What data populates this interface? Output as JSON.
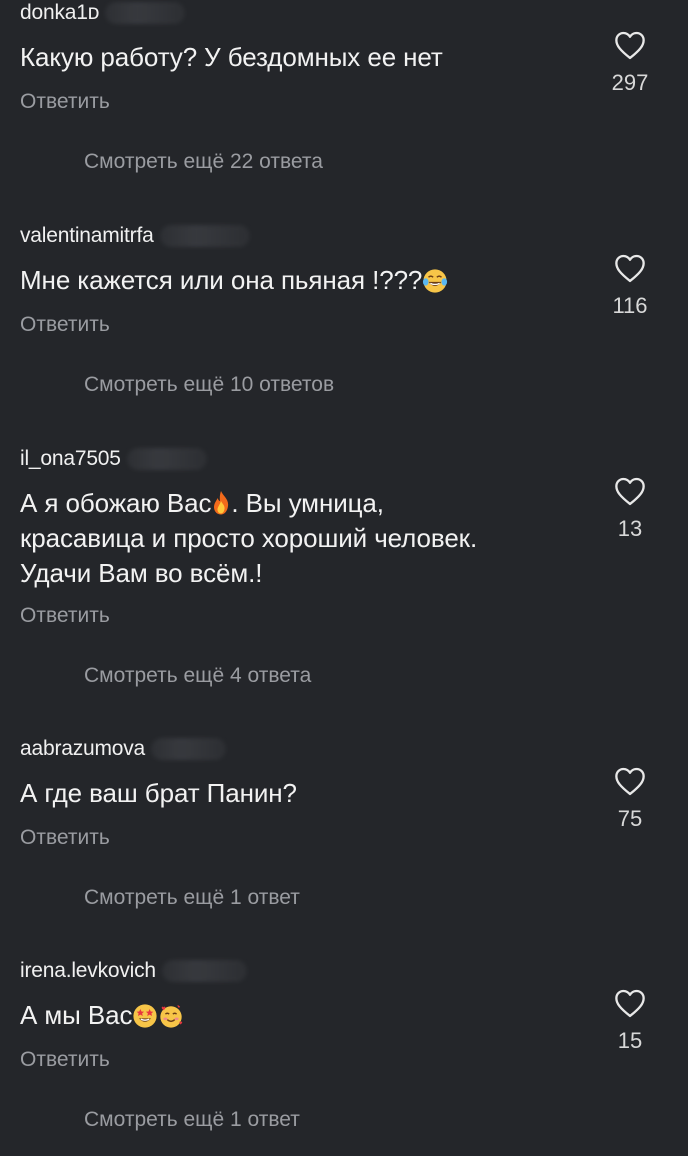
{
  "comments": [
    {
      "username": "donka1ᴅ",
      "text": "Какую работу? У бездомных ее нет",
      "reply_label": "Ответить",
      "likes": "297",
      "more_replies": "Смотреть ещё 22 ответа"
    },
    {
      "username": "valentinamitrfa",
      "text": "Мне кажется или она пьяная !???",
      "text_emoji": "laughing-tears-emoji",
      "reply_label": "Ответить",
      "likes": "116",
      "more_replies": "Смотреть ещё 10 ответов"
    },
    {
      "username": "il_ona7505",
      "text_line1_a": "А я обожаю Вас",
      "text_line1_b": ". Вы умница,",
      "text_line2": "красавица и просто хороший человек.",
      "text_line3": "Удачи Вам во всём.!",
      "text_emoji": "fire-emoji",
      "reply_label": "Ответить",
      "likes": "13",
      "more_replies": "Смотреть ещё 4 ответа"
    },
    {
      "username": "aabrazumova",
      "text": "А где ваш брат Панин?",
      "reply_label": "Ответить",
      "likes": "75",
      "more_replies": "Смотреть ещё 1 ответ"
    },
    {
      "username": "irena.levkovich",
      "text": "А мы Вас",
      "text_emojis": [
        "star-struck-emoji",
        "smiling-face-with-hearts-emoji"
      ],
      "reply_label": "Ответить",
      "likes": "15",
      "more_replies": "Смотреть ещё 1 ответ"
    }
  ],
  "colors": {
    "background": "#24262a",
    "primary_text": "#f2f2f2",
    "secondary_text": "#9a9ca1"
  }
}
